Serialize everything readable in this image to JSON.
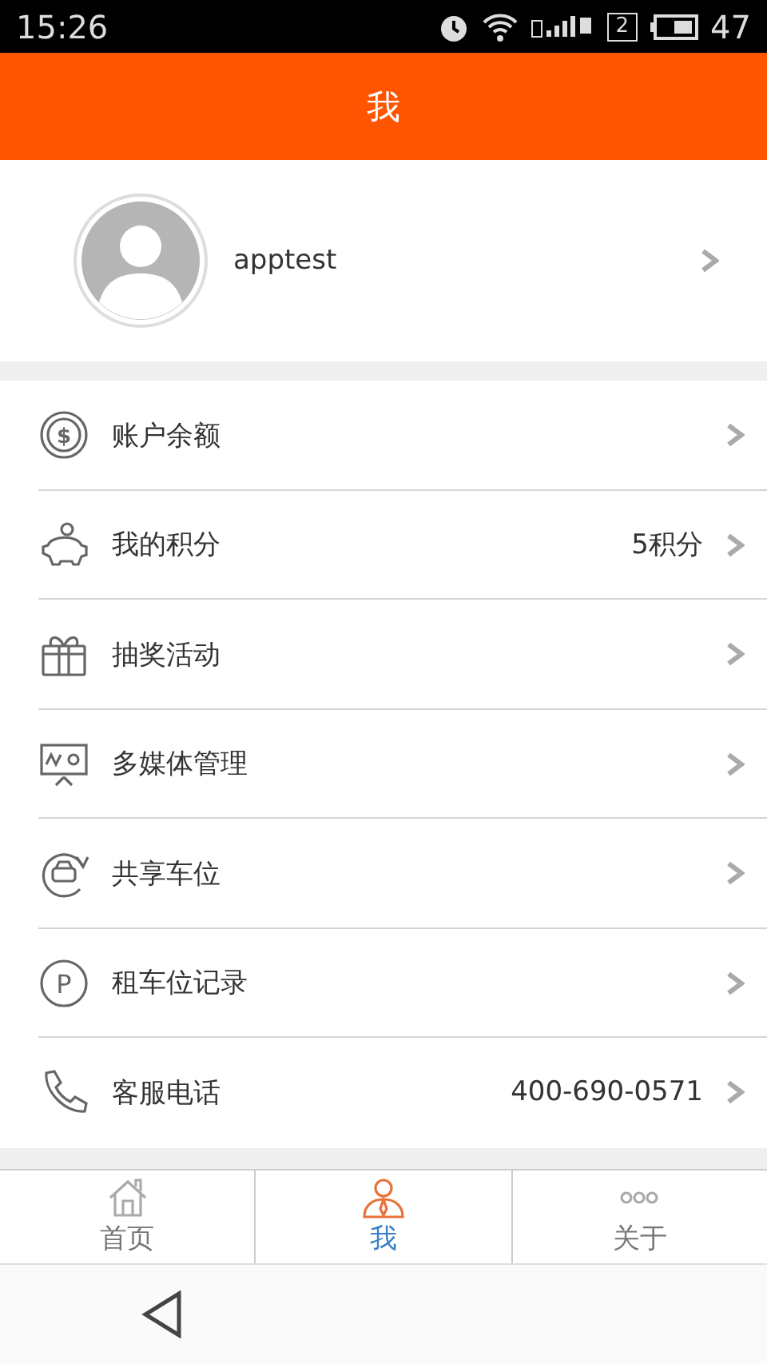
{
  "status_bar": {
    "time": "15:26",
    "sim": "2",
    "battery": "47"
  },
  "header": {
    "title": "我"
  },
  "profile": {
    "username": "apptest"
  },
  "menu": [
    {
      "kind": "balance",
      "glyph": "$",
      "label": "账户余额"
    },
    {
      "kind": "points",
      "label": "我的积分",
      "value": "5积分"
    },
    {
      "kind": "lottery",
      "label": "抽奖活动"
    },
    {
      "kind": "media",
      "label": "多媒体管理"
    },
    {
      "kind": "share",
      "label": "共享车位"
    },
    {
      "kind": "parking",
      "glyph": "P",
      "label": "租车位记录"
    },
    {
      "kind": "phone",
      "label": "客服电话",
      "value": "400-690-0571"
    }
  ],
  "tabs": [
    {
      "kind": "home",
      "label": "首页",
      "selected": false
    },
    {
      "kind": "me",
      "label": "我",
      "selected": true
    },
    {
      "kind": "about",
      "label": "关于",
      "selected": false
    }
  ]
}
